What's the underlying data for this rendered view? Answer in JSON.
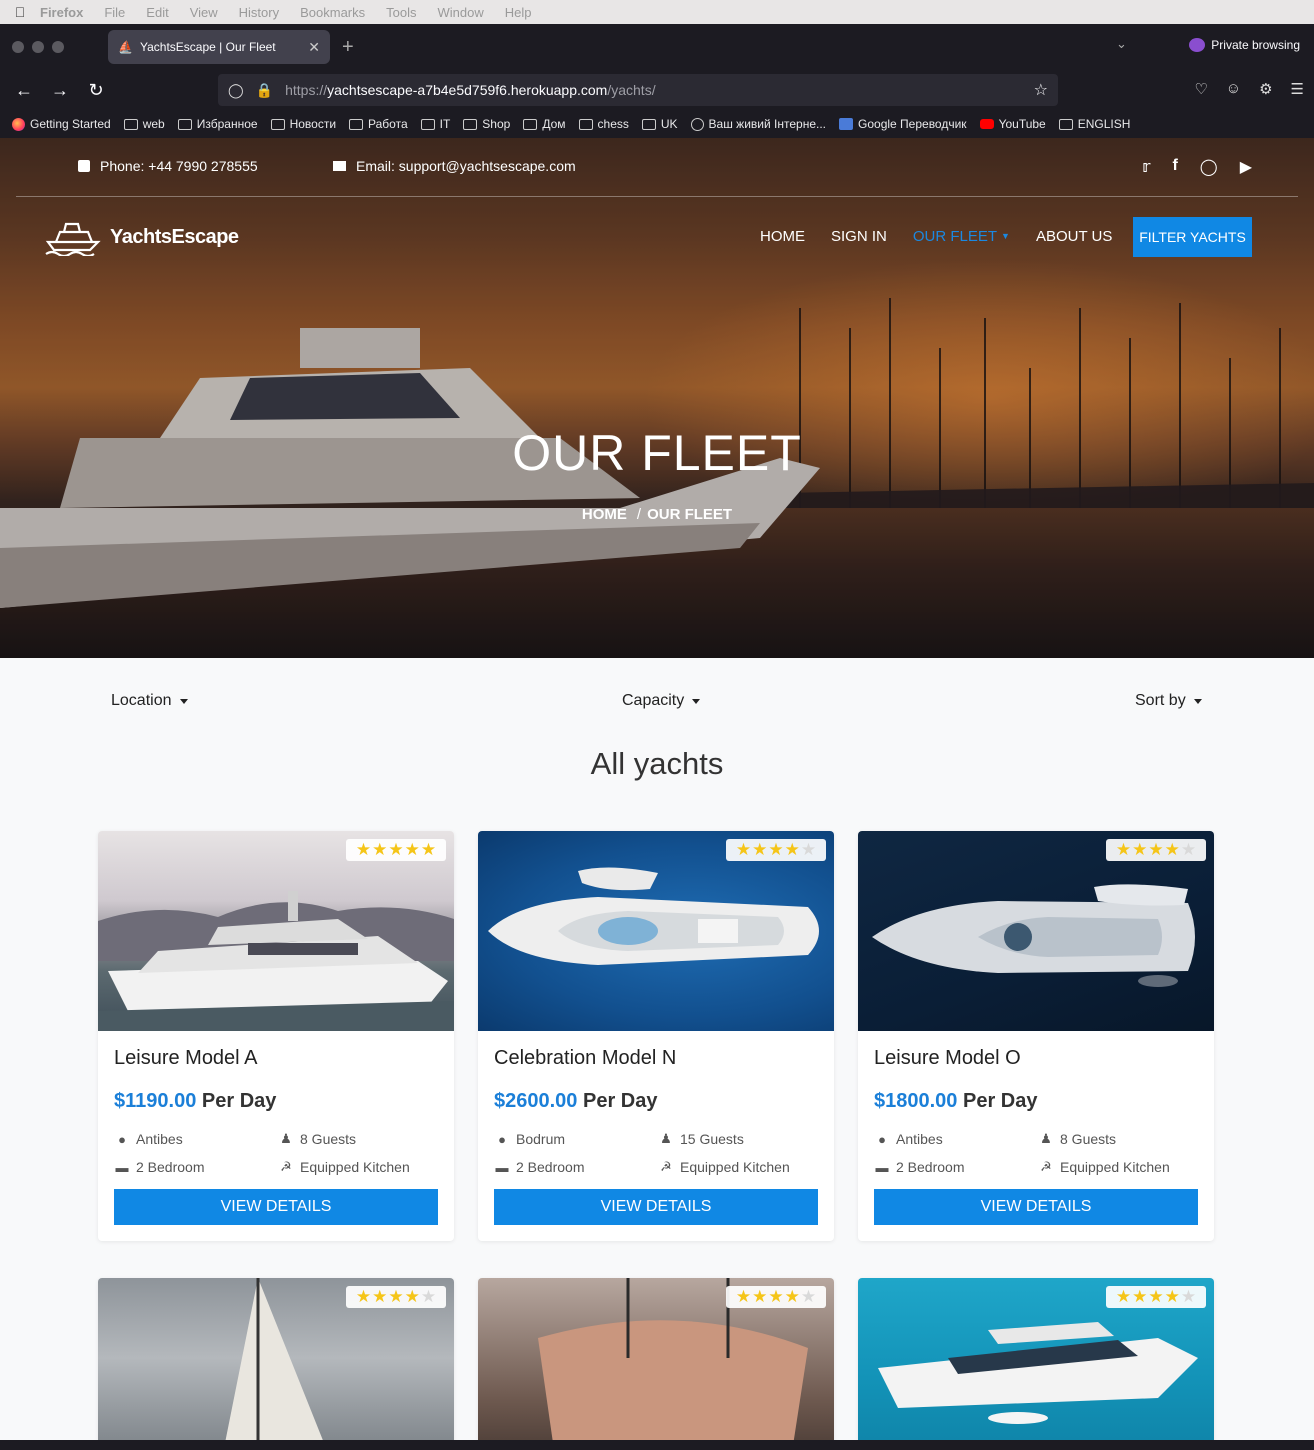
{
  "menubar": {
    "app": "Firefox",
    "items": [
      "File",
      "Edit",
      "View",
      "History",
      "Bookmarks",
      "Tools",
      "Window",
      "Help"
    ]
  },
  "browser": {
    "tab_title": "YachtsEscape | Our Fleet",
    "private_label": "Private browsing",
    "url_prefix": "https://",
    "url_host": "yachtsescape-a7b4e5d759f6.herokuapp.com",
    "url_path": "/yachts/",
    "bookmarks": [
      {
        "label": "Getting Started",
        "icon": "firefox-icon"
      },
      {
        "label": "web",
        "icon": "folder-icon"
      },
      {
        "label": "Избранное",
        "icon": "folder-icon"
      },
      {
        "label": "Новости",
        "icon": "folder-icon"
      },
      {
        "label": "Работа",
        "icon": "folder-icon"
      },
      {
        "label": "IT",
        "icon": "folder-icon"
      },
      {
        "label": "Shop",
        "icon": "folder-icon"
      },
      {
        "label": "Дом",
        "icon": "folder-icon"
      },
      {
        "label": "chess",
        "icon": "folder-icon"
      },
      {
        "label": "UK",
        "icon": "folder-icon"
      },
      {
        "label": "Ваш живий Інтерне...",
        "icon": "site-24-icon"
      },
      {
        "label": "Google Переводчик",
        "icon": "google-translate-icon"
      },
      {
        "label": "YouTube",
        "icon": "youtube-icon"
      },
      {
        "label": "ENGLISH",
        "icon": "folder-icon"
      }
    ]
  },
  "site": {
    "phone": "Phone: +44 7990 278555",
    "email": "Email: support@yachtsescape.com",
    "brand": "YachtsEscape",
    "nav": {
      "home": "HOME",
      "sign_in": "SIGN IN",
      "our_fleet": "OUR FLEET",
      "about_us": "ABOUT US",
      "filter": "FILTER YACHTS"
    },
    "hero_title": "OUR FLEET",
    "breadcrumb_home": "HOME",
    "breadcrumb_sep": "/",
    "breadcrumb_current": "OUR FLEET",
    "colors": {
      "accent": "#1088e4",
      "price": "#1b7fd8",
      "star": "#f5c518"
    }
  },
  "filters": {
    "location": "Location",
    "capacity": "Capacity",
    "sort": "Sort by"
  },
  "section_title": "All yachts",
  "yachts": [
    {
      "name": "Leisure Model A",
      "price": "$1190.00",
      "per": "Per Day",
      "rating": 5,
      "location": "Antibes",
      "guests": "8 Guests",
      "bedrooms": "2 Bedroom",
      "kitchen": "Equipped Kitchen",
      "button": "VIEW DETAILS"
    },
    {
      "name": "Celebration Model N",
      "price": "$2600.00",
      "per": "Per Day",
      "rating": 4,
      "location": "Bodrum",
      "guests": "15 Guests",
      "bedrooms": "2 Bedroom",
      "kitchen": "Equipped Kitchen",
      "button": "VIEW DETAILS"
    },
    {
      "name": "Leisure Model O",
      "price": "$1800.00",
      "per": "Per Day",
      "rating": 4,
      "location": "Antibes",
      "guests": "8 Guests",
      "bedrooms": "2 Bedroom",
      "kitchen": "Equipped Kitchen",
      "button": "VIEW DETAILS"
    },
    {
      "rating": 4
    },
    {
      "rating": 4
    },
    {
      "rating": 4
    }
  ]
}
